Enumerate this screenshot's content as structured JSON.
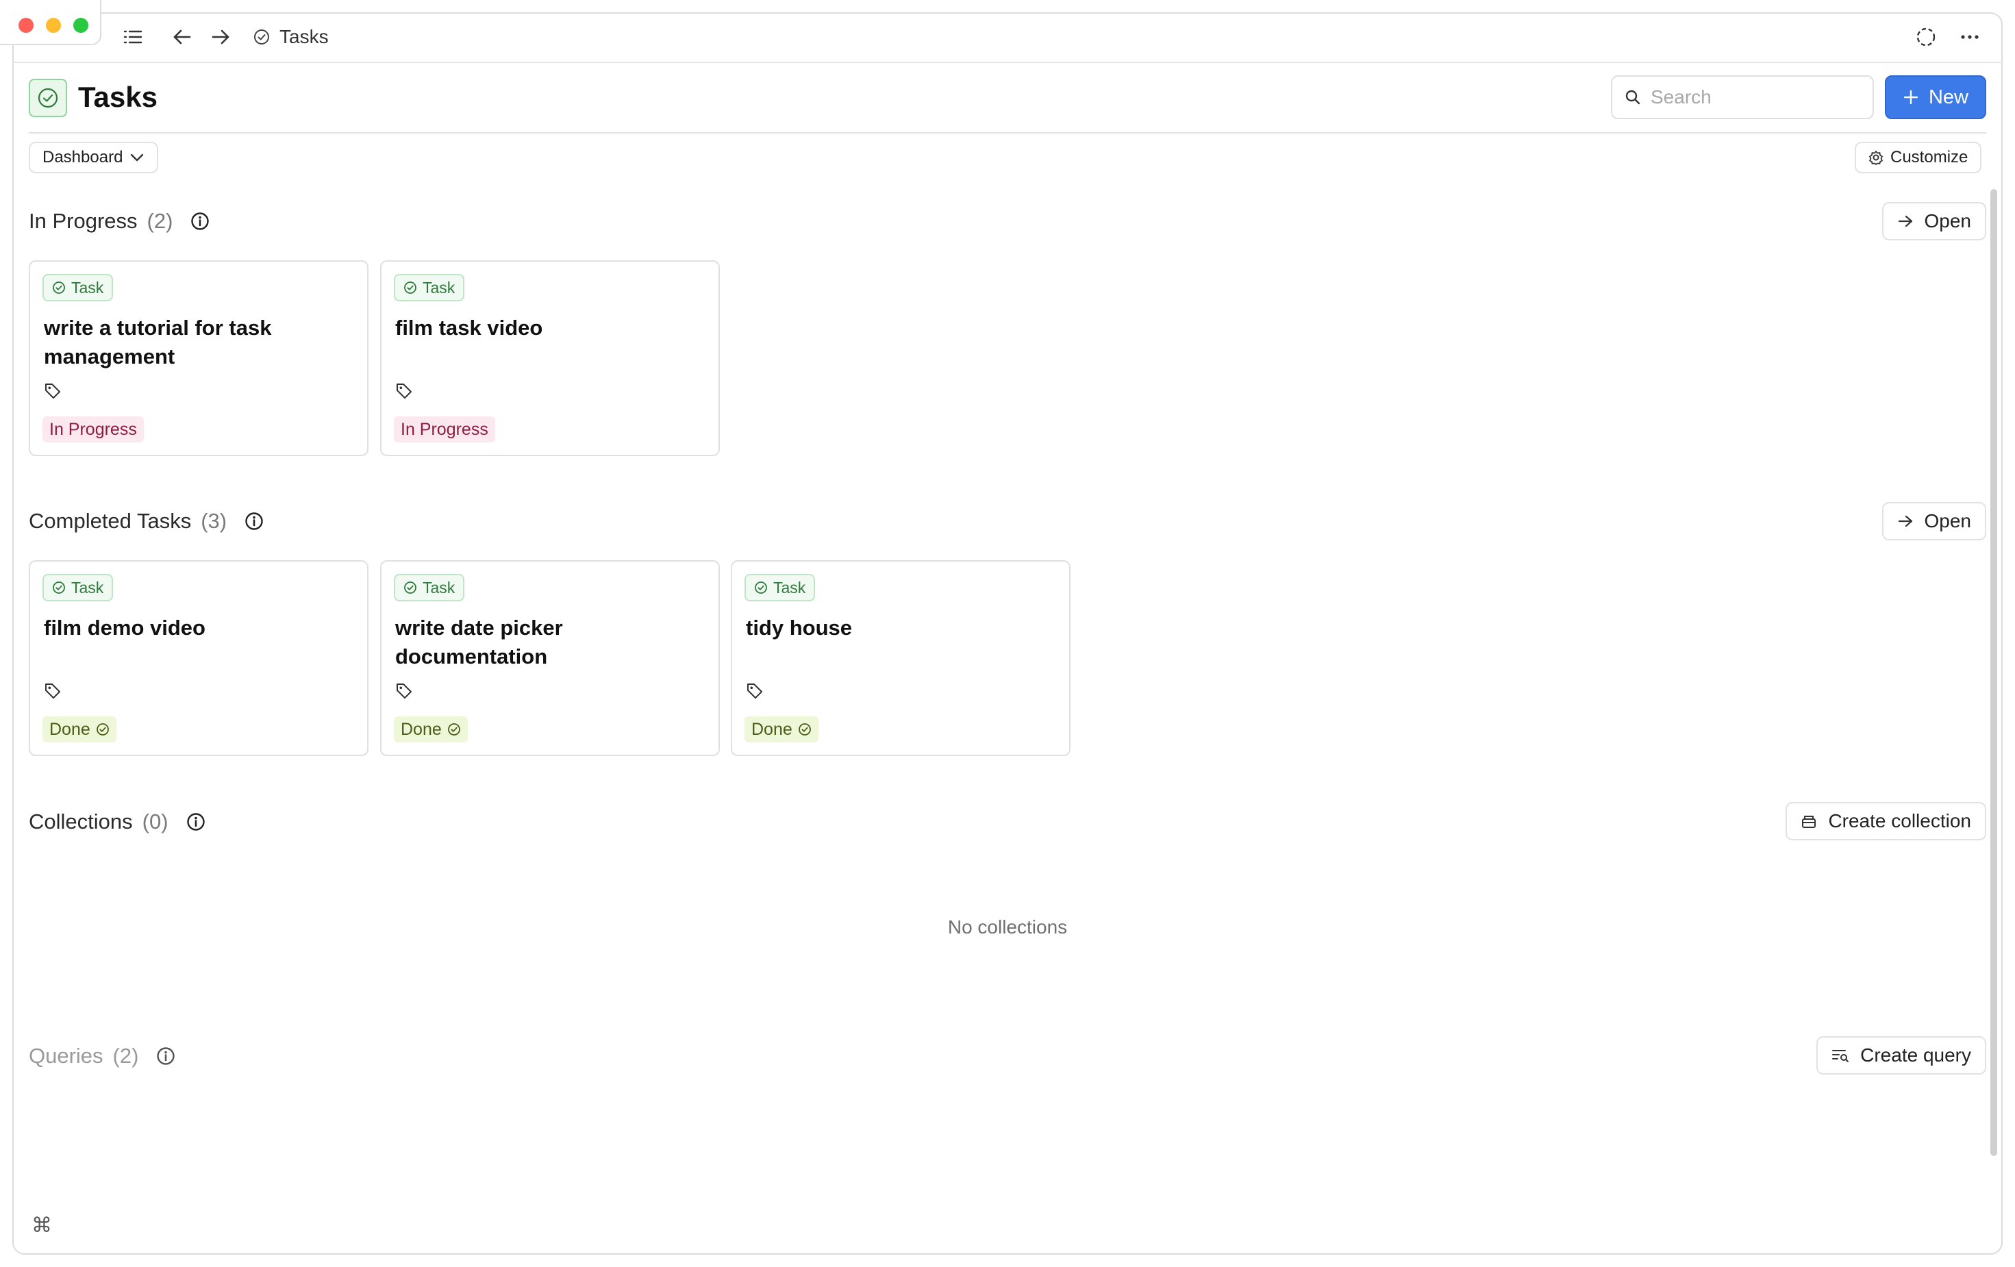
{
  "window": {
    "breadcrumb": "Tasks"
  },
  "header": {
    "title": "Tasks",
    "search_placeholder": "Search",
    "new_label": "New"
  },
  "toolbar": {
    "view_label": "Dashboard",
    "customize_label": "Customize"
  },
  "sections": {
    "in_progress": {
      "label": "In Progress",
      "count": "(2)",
      "action": "Open",
      "cards": [
        {
          "badge": "Task",
          "title": "write a tutorial for task management",
          "status": "In Progress"
        },
        {
          "badge": "Task",
          "title": "film task video",
          "status": "In Progress"
        }
      ]
    },
    "completed": {
      "label": "Completed Tasks",
      "count": "(3)",
      "action": "Open",
      "cards": [
        {
          "badge": "Task",
          "title": "film demo video",
          "status": "Done"
        },
        {
          "badge": "Task",
          "title": "write date picker documentation",
          "status": "Done"
        },
        {
          "badge": "Task",
          "title": "tidy house",
          "status": "Done"
        }
      ]
    },
    "collections": {
      "label": "Collections",
      "count": "(0)",
      "action": "Create collection",
      "empty_text": "No collections"
    },
    "queries": {
      "label": "Queries",
      "count": "(2)",
      "action": "Create query"
    }
  },
  "footer": {
    "command_glyph": "⌘"
  },
  "colors": {
    "accent": "#3b7ae8",
    "task_green": "#2f7a3c",
    "in_progress_bg": "#fbe9ef",
    "in_progress_text": "#8f1d41",
    "done_bg": "#eff7d9",
    "done_text": "#4b5e16"
  }
}
